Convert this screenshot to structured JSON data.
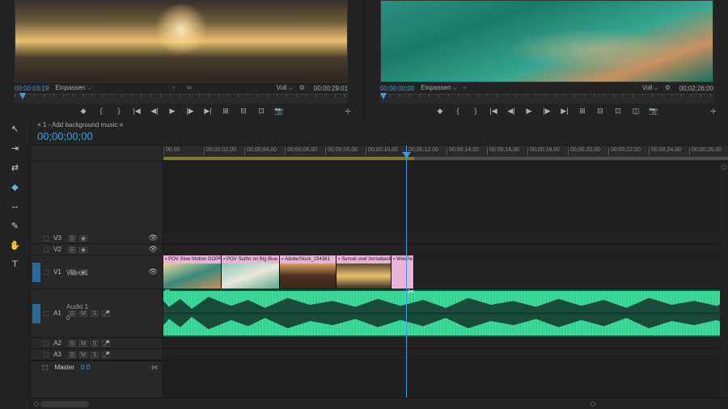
{
  "source": {
    "tc_in": "00:00:03:19",
    "fit": "Einpassen",
    "full": "Voll",
    "tc_out": "00:00:29:01"
  },
  "program": {
    "tc_in": "00;00;00;00",
    "fit": "Einpassen",
    "full": "Voll",
    "tc_out": "00;02;26;00"
  },
  "transport_icons": [
    "◆",
    "{ }",
    "|",
    "|◀",
    "◀|",
    "◀",
    "▶",
    "|▶",
    "▶|",
    "↪",
    "⊞",
    "⊟",
    "⊡",
    "📷"
  ],
  "tools": [
    {
      "name": "selection-tool",
      "glyph": "▲",
      "active": false
    },
    {
      "name": "track-select-tool",
      "glyph": "⇥",
      "active": false
    },
    {
      "name": "ripple-edit-tool",
      "glyph": "⇆",
      "active": false
    },
    {
      "name": "razor-tool",
      "glyph": "✂",
      "active": true
    },
    {
      "name": "slip-tool",
      "glyph": "↔",
      "active": false
    },
    {
      "name": "pen-tool",
      "glyph": "✎",
      "active": false
    },
    {
      "name": "hand-tool",
      "glyph": "✋",
      "active": false
    },
    {
      "name": "type-tool",
      "glyph": "T",
      "active": false
    }
  ],
  "sequence": {
    "tab": "1 - Add background music",
    "timecode": "00;00;00;00",
    "icons": [
      "⬚",
      "⌀",
      "⊓",
      "▥",
      "◢",
      "↯",
      "⚙"
    ]
  },
  "ruler_ticks": [
    "00,00",
    "00;00;02,00",
    "00;00;04,00",
    "00;00;06,00",
    "00;00;08,00",
    "00;00;10,00",
    "00;00;12,00",
    "00;00;14,00",
    "00;00;16,00",
    "00;00;18,00",
    "00;00;20,00",
    "00;00;22,00",
    "00;00;24,00",
    "00;00;26,00"
  ],
  "tracks": {
    "v3": "V3",
    "v2": "V2",
    "v1": "V1",
    "video1": "Video 1",
    "a1": "A1",
    "a2": "A2",
    "a3": "A3",
    "audio1": "Audio 1",
    "m": "M",
    "s": "S",
    "master": "Master",
    "master_val": "0.0",
    "zero": "0"
  },
  "clips": [
    {
      "name": "POV Slow Motion GOPR"
    },
    {
      "name": "POV Surfer on Big Blue O"
    },
    {
      "name": "AdobeStock_234381"
    },
    {
      "name": "Sunset over horseback riders"
    },
    {
      "name": "Welche St"
    }
  ],
  "audio_head": "▪"
}
